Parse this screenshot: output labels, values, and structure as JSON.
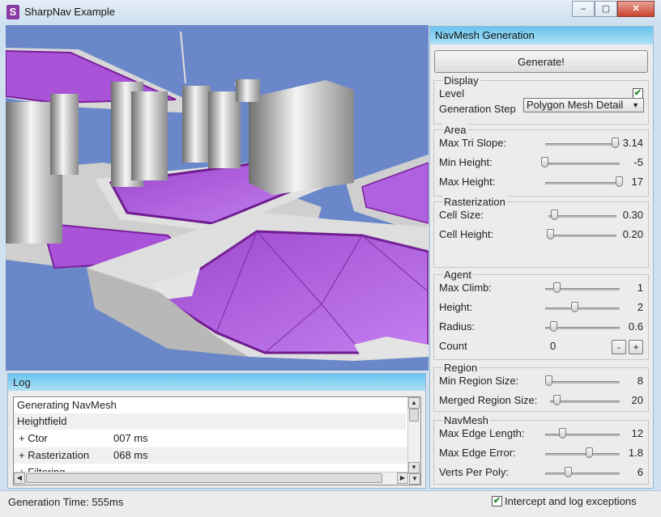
{
  "window": {
    "title": "SharpNav Example",
    "icon_letter": "S",
    "controls": {
      "minimize": "–",
      "maximize": "▢",
      "close": "✕"
    }
  },
  "panel": {
    "title": "NavMesh Generation",
    "generate_label": "Generate!",
    "display": {
      "title": "Display",
      "level_label": "Level",
      "level_checked": true,
      "step_label": "Generation Step",
      "step_value": "Polygon Mesh Detail"
    },
    "area": {
      "title": "Area",
      "rows": [
        {
          "label": "Max Tri Slope:",
          "value": "3.14",
          "fill": 0.95
        },
        {
          "label": "Min Height:",
          "value": "-5",
          "fill": 0.0
        },
        {
          "label": "Max Height:",
          "value": "17",
          "fill": 1.0
        }
      ]
    },
    "rasterization": {
      "title": "Rasterization",
      "rows": [
        {
          "label": "Cell Size:",
          "value": "0.30",
          "fill": 0.1
        },
        {
          "label": "Cell Height:",
          "value": "0.20",
          "fill": 0.04
        }
      ]
    },
    "agent": {
      "title": "Agent",
      "rows": [
        {
          "label": "Max Climb:",
          "value": "1",
          "fill": 0.16
        },
        {
          "label": "Height:",
          "value": "2",
          "fill": 0.4
        },
        {
          "label": "Radius:",
          "value": "0.6",
          "fill": 0.12
        }
      ],
      "count_label": "Count",
      "count_value": "0",
      "minus": "-",
      "plus": "+"
    },
    "region": {
      "title": "Region",
      "rows": [
        {
          "label": "Min Region Size:",
          "value": "8",
          "fill": 0.05
        },
        {
          "label": "Merged Region Size:",
          "value": "20",
          "fill": 0.1
        }
      ]
    },
    "navmesh": {
      "title": "NavMesh",
      "rows": [
        {
          "label": "Max Edge Length:",
          "value": "12",
          "fill": 0.24
        },
        {
          "label": "Max Edge Error:",
          "value": "1.8",
          "fill": 0.6
        },
        {
          "label": "Verts Per Poly:",
          "value": "6",
          "fill": 0.32
        }
      ]
    }
  },
  "log": {
    "title": "Log",
    "lines": [
      {
        "text": "Generating NavMesh",
        "ms": ""
      },
      {
        "text": "Heightfield",
        "ms": ""
      },
      {
        "text": "+ Ctor",
        "ms": "007 ms"
      },
      {
        "text": "+ Rasterization",
        "ms": "068 ms"
      },
      {
        "text": "+ Filtering",
        "ms": ""
      }
    ]
  },
  "status": {
    "generation_time": "Generation Time: 555ms",
    "exceptions_label": "Intercept and log exceptions",
    "exceptions_checked": true
  },
  "colors": {
    "navmesh": "#b25ee0",
    "sky": "#6a87c9",
    "header": "#7fd0f3"
  }
}
